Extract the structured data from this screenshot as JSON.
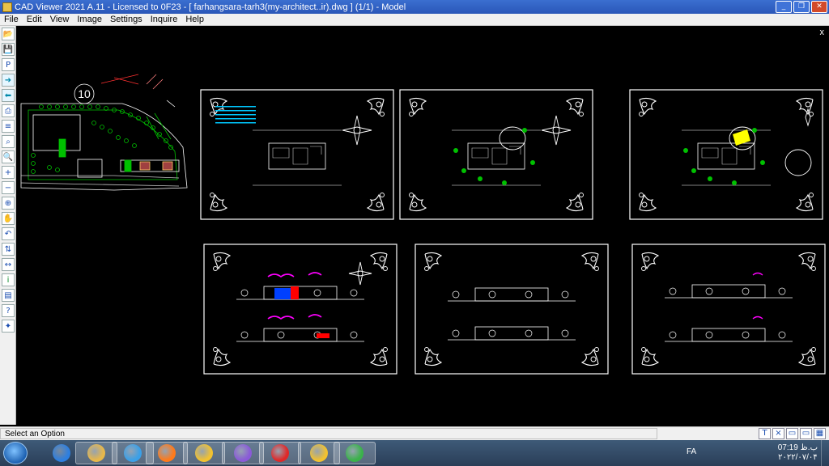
{
  "window": {
    "title": "CAD Viewer 2021 A.11 - Licensed to 0F23  -  [ farhangsara-tarh3(my-architect..ir).dwg ] (1/1)  -  Model",
    "minimize": "_",
    "restore": "❐",
    "close": "✕"
  },
  "menu": [
    "File",
    "Edit",
    "View",
    "Image",
    "Settings",
    "Inquire",
    "Help"
  ],
  "doc_close": "x",
  "toolbar": [
    {
      "icon": "open-folder-icon",
      "glyph": "📂"
    },
    {
      "icon": "save-icon",
      "glyph": "💾"
    },
    {
      "icon": "pdf-icon",
      "glyph": "P"
    },
    {
      "icon": "arrow-right-icon",
      "glyph": "➜"
    },
    {
      "icon": "arrow-left-icon",
      "glyph": "⬅"
    },
    {
      "icon": "print-icon",
      "glyph": "⎙"
    },
    {
      "icon": "layers-icon",
      "glyph": "≡"
    },
    {
      "icon": "binoculars-icon",
      "glyph": "⌕"
    },
    {
      "icon": "zoom-icon",
      "glyph": "🔍"
    },
    {
      "icon": "zoom-in-icon",
      "glyph": "+"
    },
    {
      "icon": "zoom-out-icon",
      "glyph": "−"
    },
    {
      "icon": "zoom-window-icon",
      "glyph": "⊕"
    },
    {
      "icon": "pan-icon",
      "glyph": "✋"
    },
    {
      "icon": "undo-icon",
      "glyph": "↶"
    },
    {
      "icon": "measure-icon",
      "glyph": "⇅"
    },
    {
      "icon": "measure-distance-icon",
      "glyph": "↔"
    },
    {
      "icon": "info-icon",
      "glyph": "i"
    },
    {
      "icon": "book-icon",
      "glyph": "▤"
    },
    {
      "icon": "help-icon",
      "glyph": "?"
    },
    {
      "icon": "plugin-icon",
      "glyph": "✦"
    }
  ],
  "canvas": {
    "label_10": "10"
  },
  "status": {
    "text": "Select an Option",
    "icons": [
      {
        "icon": "text-icon",
        "glyph": "T"
      },
      {
        "icon": "close-small-icon",
        "glyph": "×"
      },
      {
        "icon": "window-icon",
        "glyph": "▭"
      },
      {
        "icon": "window-icon",
        "glyph": "▭"
      },
      {
        "icon": "grid-icon",
        "glyph": "▦"
      }
    ]
  },
  "taskbar": {
    "apps": [
      "internet-explorer",
      "file-explorer",
      "media-player",
      "firefox",
      "chrome",
      "visual-studio",
      "opera",
      "chrome-user",
      "cad-viewer"
    ],
    "lang": "FA",
    "time": "07:19 ب.ظ",
    "date": "۲۰۲۲/۰۷/۰۴"
  },
  "colors": {
    "titlebar": "#2a56b8",
    "canvas": "#000000",
    "drawing": "#ffffff",
    "accent_green": "#00c000",
    "accent_magenta": "#ff00ff",
    "accent_red": "#ff0000",
    "accent_blue": "#0040ff",
    "accent_yellow": "#ffff00"
  }
}
